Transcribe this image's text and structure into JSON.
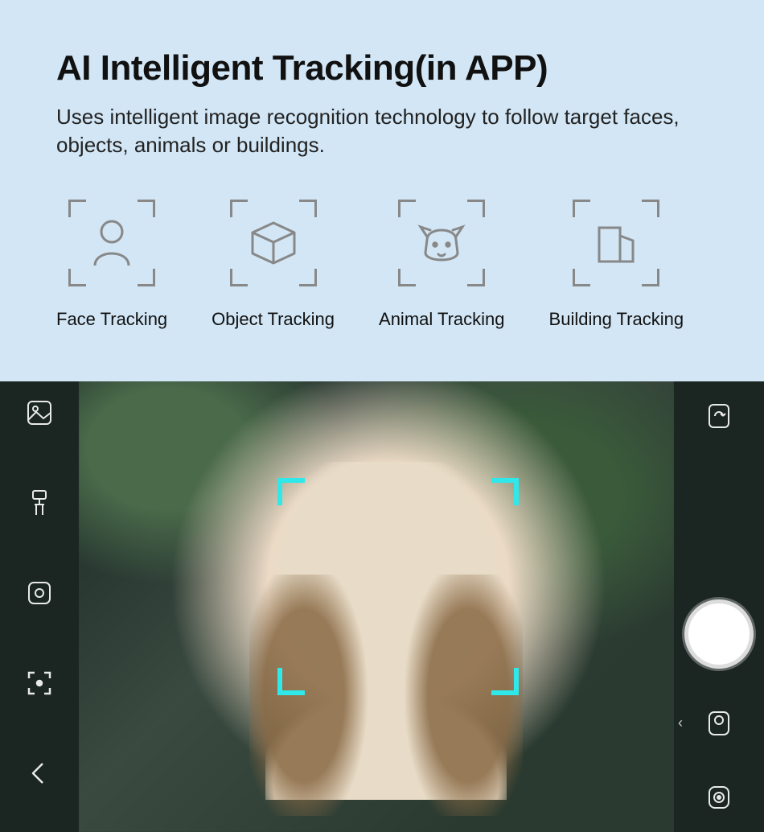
{
  "header": {
    "title": "AI Intelligent Tracking(in APP)",
    "description": "Uses intelligent image recognition technology to follow target faces, objects, animals or buildings."
  },
  "features": [
    {
      "label": "Face Tracking",
      "icon": "person-icon"
    },
    {
      "label": "Object Tracking",
      "icon": "cube-icon"
    },
    {
      "label": "Animal Tracking",
      "icon": "dog-icon"
    },
    {
      "label": "Building Tracking",
      "icon": "buildings-icon"
    }
  ],
  "camera": {
    "tracking_color": "#2fe8ea",
    "left_tools": [
      "gallery-icon",
      "gimbal-icon",
      "lens-icon",
      "focus-icon",
      "back-icon"
    ],
    "right_tools": [
      "rotate-icon",
      "switch-camera-icon",
      "settings-camera-icon"
    ]
  }
}
